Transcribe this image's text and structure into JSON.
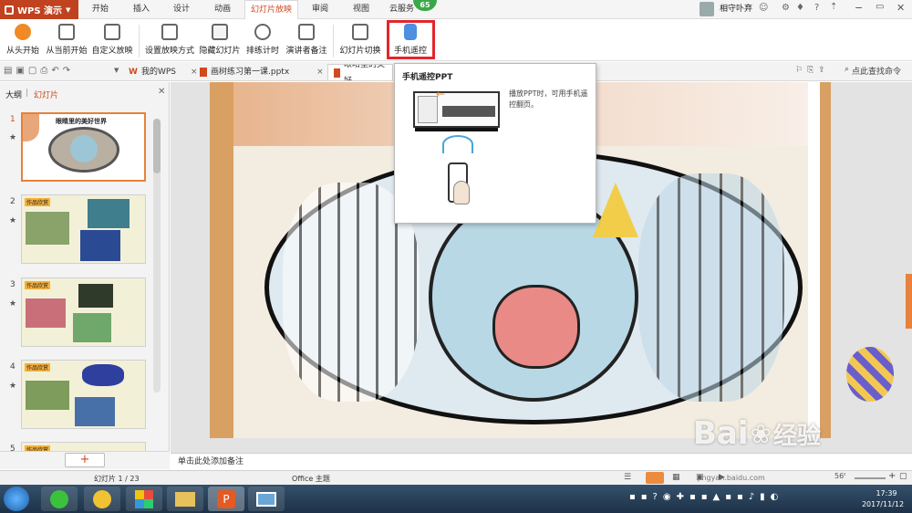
{
  "app": {
    "logo_label": "WPS 演示",
    "update_badge": "65"
  },
  "menu": {
    "tabs": [
      "开始",
      "插入",
      "设计",
      "动画",
      "幻灯片放映",
      "审阅",
      "视图",
      "云服务"
    ],
    "active_tab": "幻灯片放映",
    "user_name": "相守卟弃"
  },
  "ribbon": {
    "buttons": [
      "从头开始",
      "从当前开始",
      "自定义放映",
      "设置放映方式",
      "隐藏幻灯片",
      "排练计时",
      "演讲者备注",
      "幻灯片切换",
      "手机遥控"
    ],
    "highlighted": "手机遥控"
  },
  "doc_tabs": {
    "items": [
      "我的WPS",
      "画树练习第一课.pptx",
      "眼睛里的美好"
    ],
    "search_label": "点此查找命令"
  },
  "sidebar": {
    "tab_outline": "大纲",
    "tab_slides": "幻灯片",
    "slide_numbers": [
      "1",
      "2",
      "3",
      "4",
      "5"
    ],
    "slide1_title": "眼睛里的美好世界",
    "slide_tag": "作品欣赏"
  },
  "popup": {
    "title": "手机遥控PPT",
    "description": "播放PPT时，可用手机遥控翻页。"
  },
  "notes": {
    "placeholder": "单击此处添加备注"
  },
  "status": {
    "slide_counter": "幻灯片 1 / 23",
    "theme": "Office 主题",
    "watermark_site": "jingyan.baidu.com",
    "zoom_value": "56%"
  },
  "watermark": {
    "brand": "Bai",
    "brand2": "经验"
  },
  "taskbar": {
    "time": "17:39",
    "date": "2017/11/12"
  },
  "colors": {
    "accent": "#d1491f",
    "logo_bg": "#c1421f",
    "highlight_box": "#e3262b",
    "selected_slide_border": "#e8813b"
  }
}
